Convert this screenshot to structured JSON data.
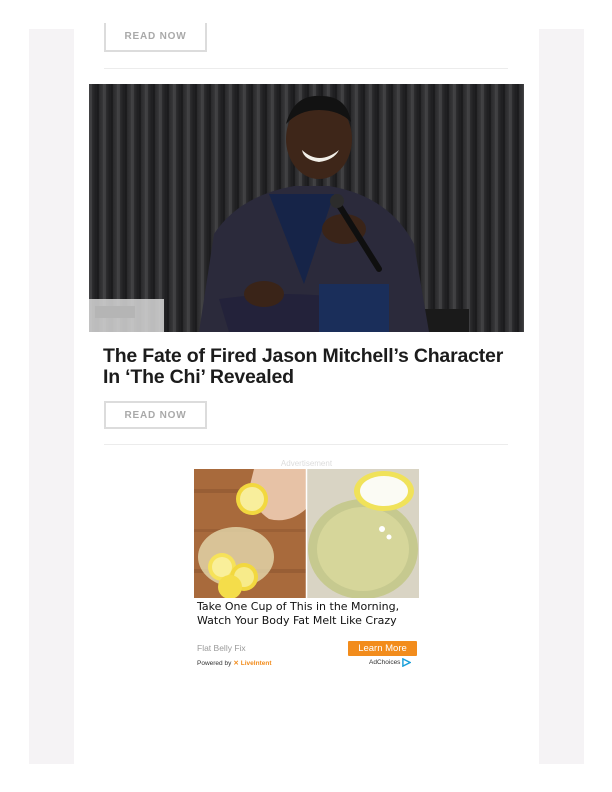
{
  "top_card": {
    "read_now_label": "READ NOW"
  },
  "article": {
    "image_alt": "Jason Mitchell smiling, seated on stage holding a microphone",
    "headline_line1": "The Fate of Fired Jason Mitchell’s Character",
    "headline_line2": "In ‘The Chi’ Revealed",
    "read_now_label": "READ NOW"
  },
  "ad": {
    "label": "Advertisement",
    "headline": "Take One Cup of This in the Morning, Watch Your Body Fat Melt Like Crazy",
    "source": "Flat Belly Fix",
    "cta_label": "Learn More",
    "powered_by_prefix": "Powered by",
    "powered_by_brand": "LiveIntent",
    "adchoices_label": "AdChoices"
  },
  "colors": {
    "accent_orange": "#f28c1c",
    "sidebar_bg": "#f5f3f5",
    "button_border": "#dcdcdc",
    "headline": "#1c1c1c"
  }
}
